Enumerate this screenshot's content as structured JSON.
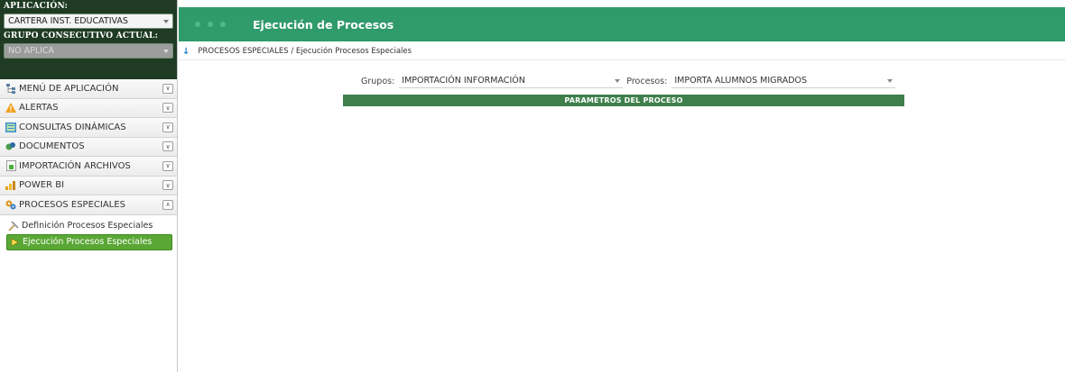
{
  "sidebar": {
    "app_label": "APLICACIÓN:",
    "app_value": "CARTERA INST. EDUCATIVAS",
    "group_label": "GRUPO CONSECUTIVO ACTUAL:",
    "group_value": "NO APLICA",
    "menu": [
      {
        "label": "MENÚ DE APLICACIÓN",
        "icon": "sitemap-icon"
      },
      {
        "label": "ALERTAS",
        "icon": "warning-icon"
      },
      {
        "label": "CONSULTAS DINÁMICAS",
        "icon": "query-icon"
      },
      {
        "label": "DOCUMENTOS",
        "icon": "documents-icon"
      },
      {
        "label": "IMPORTACIÓN ARCHIVOS",
        "icon": "import-icon"
      },
      {
        "label": "POWER BI",
        "icon": "chart-icon"
      },
      {
        "label": "PROCESOS ESPECIALES",
        "icon": "gears-icon"
      }
    ],
    "sub_items": [
      {
        "label": "Definición Procesos Especiales",
        "icon": "tools-icon"
      },
      {
        "label": "Ejecución Procesos Especiales",
        "icon": "play-icon"
      }
    ]
  },
  "header": {
    "title": "Ejecución de Procesos"
  },
  "breadcrumb": {
    "text": "PROCESOS ESPECIALES / Ejecución Procesos Especiales"
  },
  "form": {
    "groups_label": "Grupos:",
    "groups_value": "IMPORTACIÓN INFORMACIÓN",
    "processes_label": "Procesos:",
    "processes_value": "IMPORTA ALUMNOS MIGRADOS"
  },
  "params_header": "PARAMETROS DEL PROCESO",
  "colors": {
    "header": "#2f9a6a",
    "sidebar_top": "#1f3b24",
    "active_item": "#5aa735",
    "params_bar": "#3f7f4b"
  }
}
